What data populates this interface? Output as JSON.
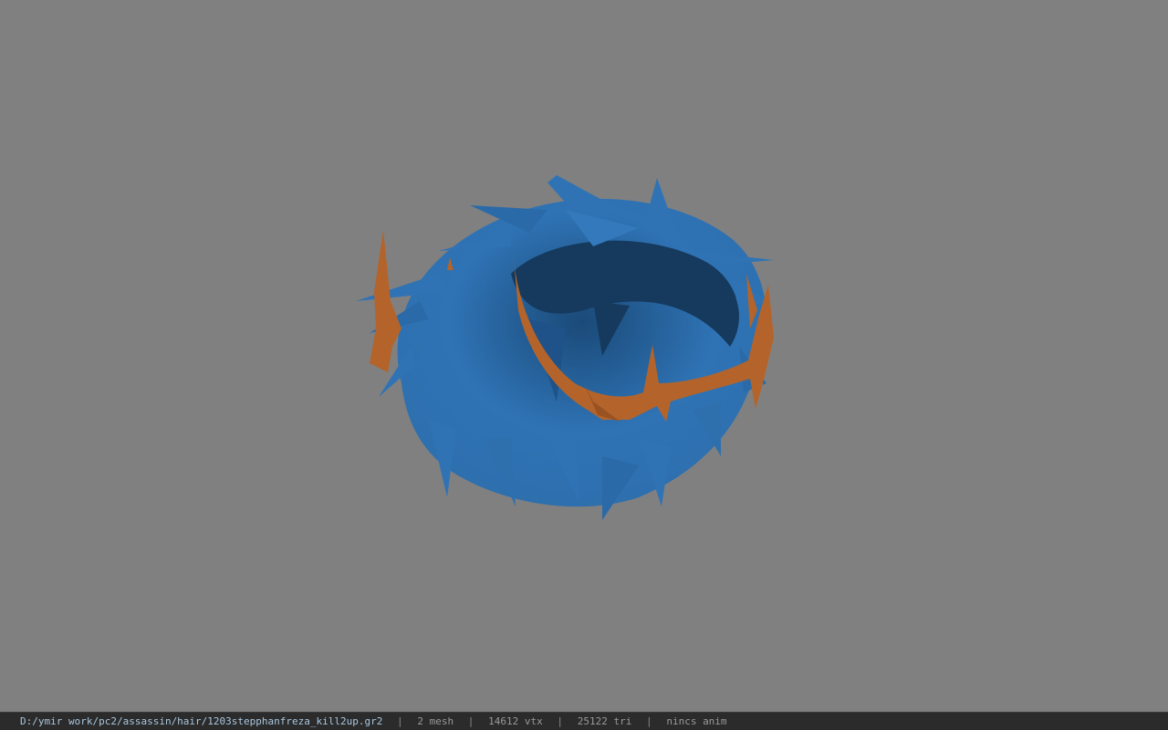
{
  "viewport": {
    "model_name": "hair mesh",
    "colors": {
      "background": "#808080",
      "hair": "#2f73b5",
      "hair_dark": "#163a5e",
      "ornament": "#b4642a"
    }
  },
  "statusbar": {
    "path": "D:/ymir work/pc2/assassin/hair/1203stepphanfreza_kill2up.gr2",
    "separator": "|",
    "mesh": "2 mesh",
    "vertices": "14612 vtx",
    "triangles": "25122 tri",
    "anim": "nincs anim"
  }
}
